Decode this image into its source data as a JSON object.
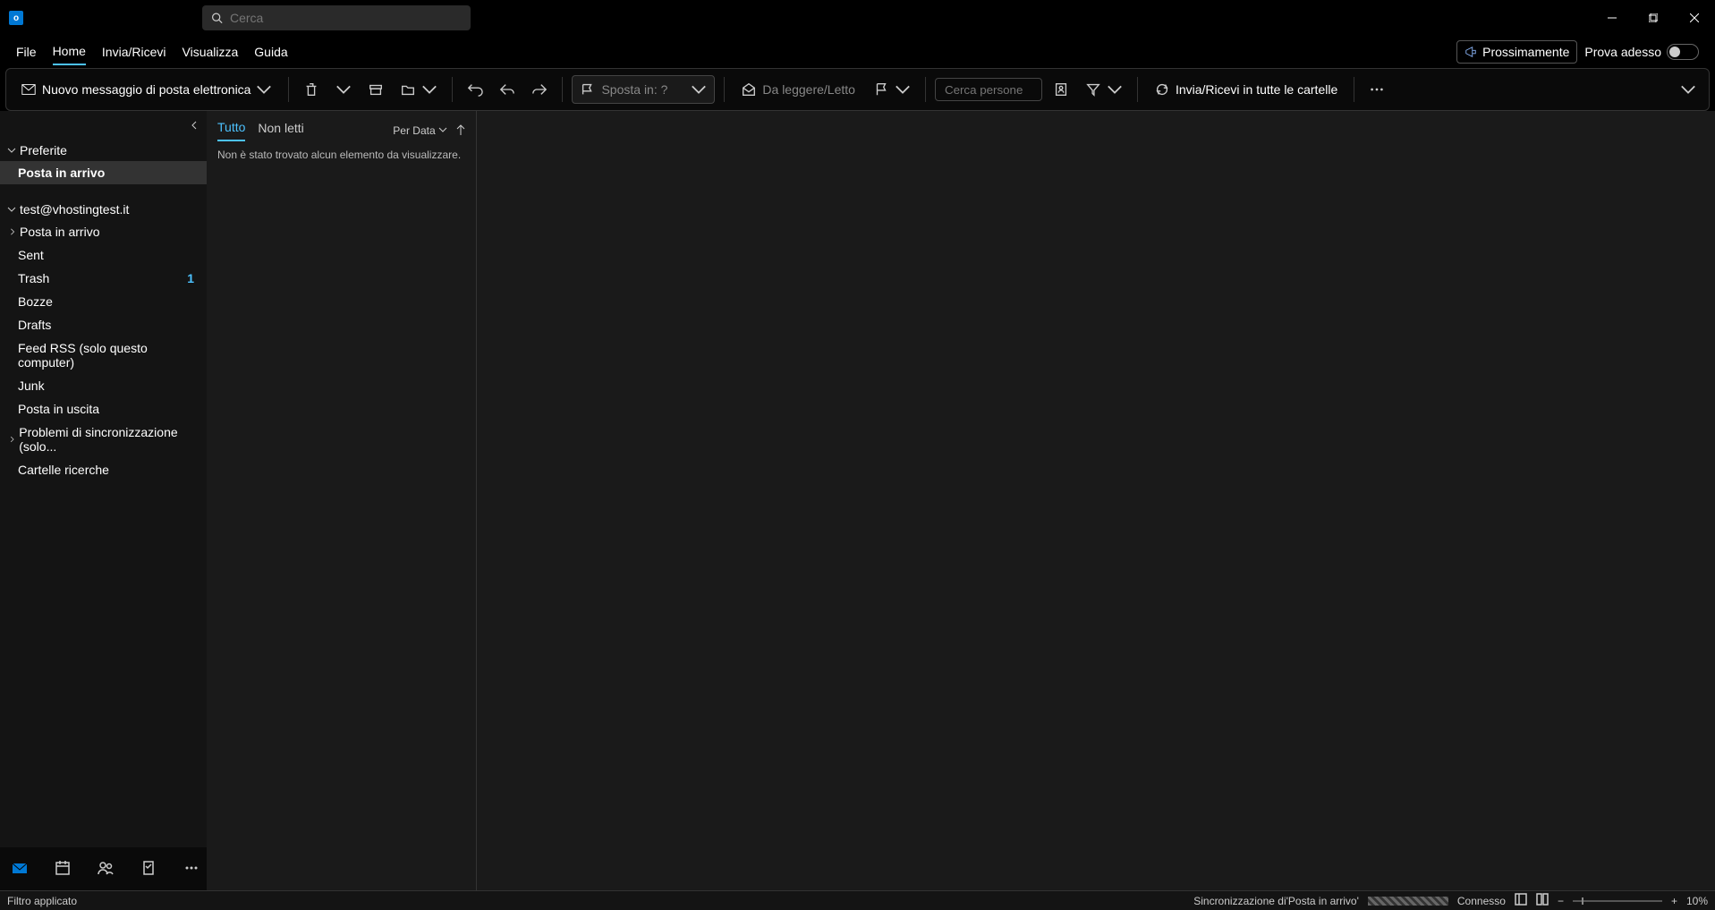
{
  "titlebar": {
    "search_placeholder": "Cerca"
  },
  "menubar": {
    "file": "File",
    "home": "Home",
    "send_receive": "Invia/Ricevi",
    "view": "Visualizza",
    "help": "Guida",
    "coming_soon": "Prossimamente",
    "try_now": "Prova adesso"
  },
  "ribbon": {
    "new_email": "Nuovo messaggio di posta elettronica",
    "move_to": "Sposta in: ?",
    "read_unread": "Da leggere/Letto",
    "search_people": "Cerca persone",
    "send_receive_all": "Invia/Ricevi in tutte le cartelle"
  },
  "sidebar": {
    "favorites_label": "Preferite",
    "favorites": [
      {
        "label": "Posta in arrivo"
      }
    ],
    "account": "test@vhostingtest.it",
    "folders": [
      {
        "label": "Posta in arrivo",
        "expandable": true
      },
      {
        "label": "Sent"
      },
      {
        "label": "Trash",
        "count": "1"
      },
      {
        "label": "Bozze"
      },
      {
        "label": "Drafts"
      },
      {
        "label": "Feed RSS (solo questo computer)"
      },
      {
        "label": "Junk"
      },
      {
        "label": "Posta in uscita"
      },
      {
        "label": "Problemi di sincronizzazione (solo...",
        "expandable": true
      },
      {
        "label": "Cartelle ricerche"
      }
    ]
  },
  "message_list": {
    "tab_all": "Tutto",
    "tab_unread": "Non letti",
    "sort_label": "Per Data",
    "empty": "Non è stato trovato alcun elemento da visualizzare."
  },
  "statusbar": {
    "filter": "Filtro applicato",
    "sync": "Sincronizzazione di'Posta in arrivo'",
    "connected": "Connesso",
    "zoom": "10%"
  }
}
